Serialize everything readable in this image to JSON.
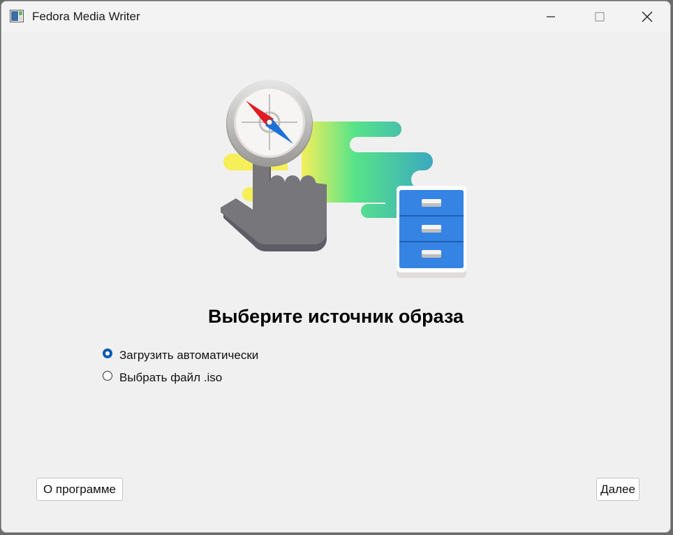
{
  "window": {
    "title": "Fedora Media Writer",
    "controls": {
      "minimize_icon": "minimize-icon",
      "maximize_icon": "maximize-icon",
      "close_icon": "close-icon"
    }
  },
  "main": {
    "heading": "Выберите источник образа",
    "options": [
      {
        "label": "Загрузить автоматически",
        "selected": true
      },
      {
        "label": "Выбрать файл .iso",
        "selected": false
      }
    ]
  },
  "footer": {
    "about_label": "О программе",
    "next_label": "Далее"
  },
  "colors": {
    "accent": "#0a5bb3",
    "cabinet_blue": "#3584e4",
    "compass_red": "#e01b24",
    "hand_gray": "#77767b"
  }
}
